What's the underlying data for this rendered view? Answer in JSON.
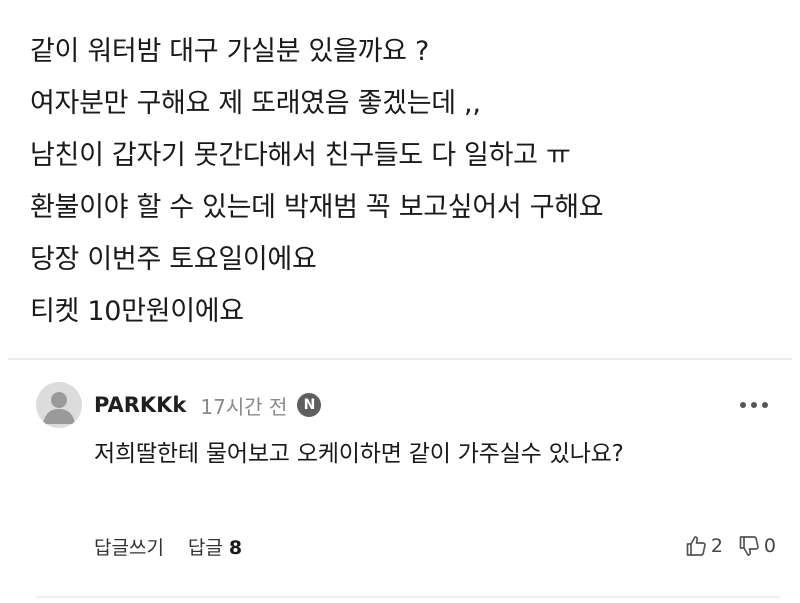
{
  "post": {
    "lines": [
      "같이 워터밤 대구 가실분 있을까요 ?",
      "여자분만 구해요 제 또래였음 좋겠는데 ,,",
      "남친이 갑자기 못간다해서 친구들도 다 일하고 ㅠ",
      "환불이야 할 수 있는데 박재범 꼭 보고싶어서 구해요",
      "당장 이번주 토요일이에요",
      "티켓 10만원이에요"
    ]
  },
  "comment": {
    "author": "PARKKk",
    "time": "17시간 전",
    "badge": "N",
    "text": "저희딸한테 물어보고 오케이하면 같이 가주실수 있나요?",
    "reply_write_label": "답글쓰기",
    "reply_label": "답글",
    "reply_count": "8",
    "like_count": "2",
    "dislike_count": "0"
  },
  "icons": {
    "avatar": "default-user-avatar",
    "more": "more-horizontal-icon",
    "like": "thumbs-up-icon",
    "dislike": "thumbs-down-icon"
  },
  "colors": {
    "text": "#1a1a1a",
    "muted": "#8a8a8a",
    "badge_bg": "#5f5f5f",
    "avatar_bg": "#dcdcdc",
    "divider": "#ececec"
  }
}
